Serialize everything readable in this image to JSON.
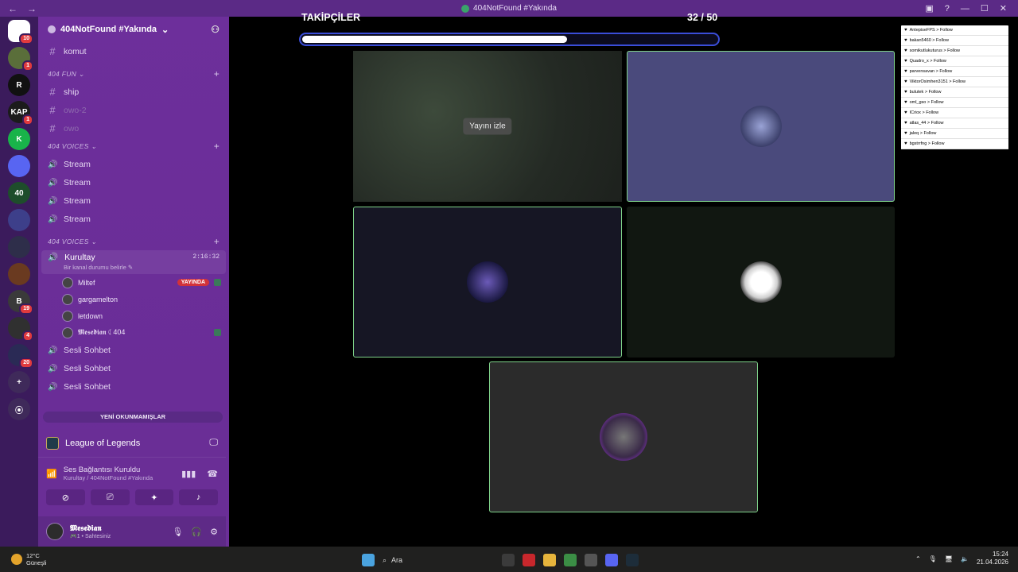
{
  "window": {
    "title": "404NotFound #Yakında",
    "back": "←",
    "forward": "→"
  },
  "servers": [
    {
      "label": "",
      "badge": "10",
      "color": "#ffffff"
    },
    {
      "label": "",
      "badge": "1",
      "color": "#5a6e3a"
    },
    {
      "label": "R",
      "badge": "",
      "color": "#111111"
    },
    {
      "label": "KAP",
      "badge": "1",
      "color": "#1b1b1b"
    },
    {
      "label": "K",
      "badge": "",
      "color": "#19b34a"
    },
    {
      "label": "",
      "badge": "",
      "color": "#5865f2"
    },
    {
      "label": "40",
      "badge": "",
      "color": "#1e4d2b"
    },
    {
      "label": "",
      "badge": "",
      "color": "#3d3f8a"
    },
    {
      "label": "",
      "badge": "",
      "color": "#2e2e4a"
    },
    {
      "label": "",
      "badge": "",
      "color": "#6a3a20"
    },
    {
      "label": "B",
      "badge": "19",
      "color": "#3a3a3a"
    },
    {
      "label": "",
      "badge": "4",
      "color": "#303030"
    },
    {
      "label": "",
      "badge": "20",
      "color": "#2a2a55"
    },
    {
      "label": "+",
      "badge": "",
      "color": "#3f2a5a"
    },
    {
      "label": "⦿",
      "badge": "",
      "color": "#3f2a5a"
    }
  ],
  "guild": {
    "name": "404NotFound #Yakında",
    "chevron": "⌄",
    "invite": "⚇"
  },
  "channels_top": [
    {
      "name": "komut"
    }
  ],
  "cat_fun": {
    "name": "404 FUN ⌄"
  },
  "fun_channels": [
    {
      "name": "ship",
      "dim": false
    },
    {
      "name": "owo-2",
      "dim": true
    },
    {
      "name": "owo",
      "dim": true
    }
  ],
  "cat_voices1": {
    "name": "404 VOICES ⌄"
  },
  "voice_channels1": [
    {
      "name": "Stream"
    },
    {
      "name": "Stream"
    },
    {
      "name": "Stream"
    },
    {
      "name": "Stream"
    }
  ],
  "cat_voices2": {
    "name": "404 VOICES ⌄"
  },
  "active_voice": {
    "name": "Kurultay",
    "time": "2:16:32",
    "status": "Bir kanal durumu belirle ✎"
  },
  "members": [
    {
      "name": "Miltef",
      "live": "YAYINDA",
      "screen": true
    },
    {
      "name": "gargamelton",
      "live": "",
      "screen": false
    },
    {
      "name": "letdown",
      "live": "",
      "screen": false
    },
    {
      "name": "𝕸𝖊𝖘𝖊𝖉𝖎𝖆𝖓 ☾404",
      "live": "",
      "screen": true
    }
  ],
  "voice_channels2": [
    {
      "name": "Sesli Sohbet"
    },
    {
      "name": "Sesli Sohbet"
    },
    {
      "name": "Sesli Sohbet"
    }
  ],
  "new_unread": "YENİ OKUNMAMIŞLAR",
  "activity": {
    "game": "League of Legends"
  },
  "connection": {
    "title": "Ses Bağlantısı Kuruldu",
    "sub": "Kurultay / 404NotFound #Yakında"
  },
  "user": {
    "name": "𝕸𝖊𝖘𝖊𝖉𝖎𝖆𝖓",
    "status": "🎮1 • Sahtesiniz"
  },
  "progress": {
    "title": "TAKİPÇİLER",
    "count": "32 / 50",
    "fraction": 0.64
  },
  "watch_button": "Yayını izle",
  "follow_feed": [
    "AntepiseFPS > Follow",
    "bakan5460 > Follow",
    "somikutlukuturus > Follow",
    "Quadro_x > Follow",
    "parvensavan > Follow",
    "ViktorOsimhen3151 > Follow",
    "bulutek > Follow",
    "oml_gso > Follow",
    "ICriox > Follow",
    "atlas_44 > Follow",
    "jaleq > Follow",
    "bgstrrfng > Follow"
  ],
  "taskbar": {
    "temp": "12°C",
    "weather": "Güneşli",
    "search": "Ara",
    "time": "15:24",
    "date": "21.04.2026"
  }
}
